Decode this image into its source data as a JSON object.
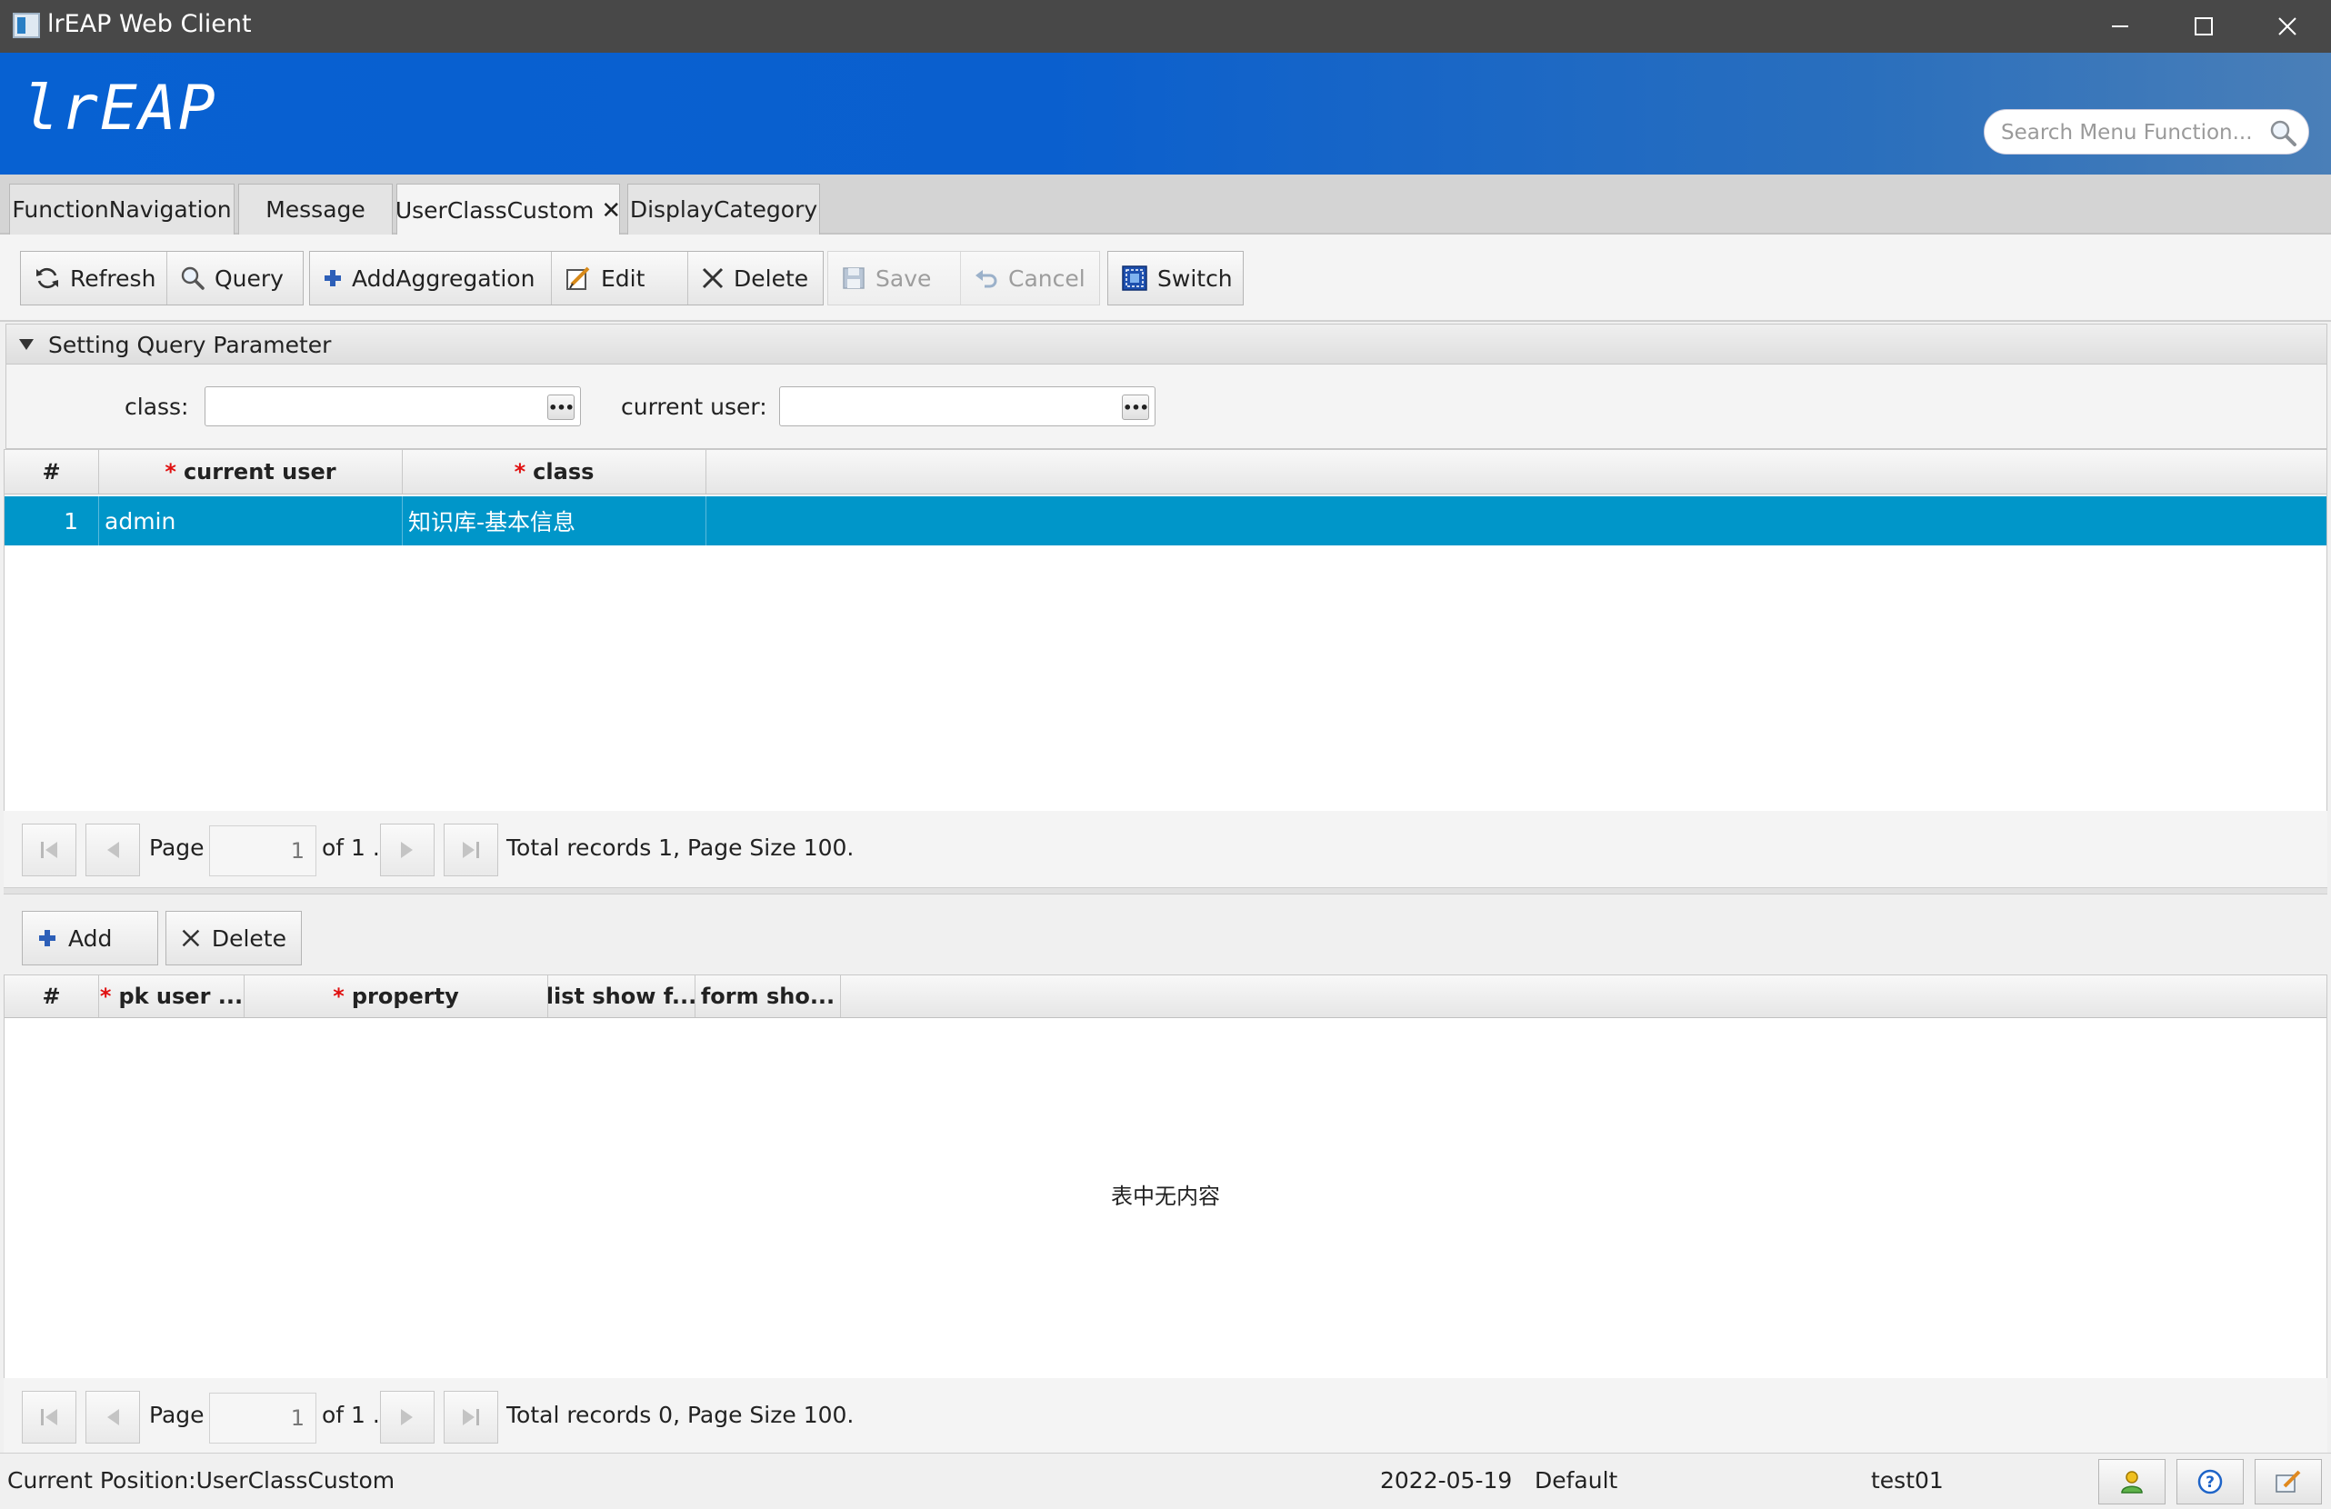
{
  "window": {
    "title": "lrEAP Web Client",
    "minimize": "—",
    "maximize": "☐",
    "close": "✕"
  },
  "banner": {
    "logo": "lrEAP",
    "search_placeholder": "Search Menu Function..."
  },
  "tabs": [
    {
      "label": "FunctionNavigation",
      "active": false
    },
    {
      "label": "Message",
      "active": false
    },
    {
      "label": "UserClassCustom",
      "active": true,
      "closable": true
    },
    {
      "label": "DisplayCategory",
      "active": false
    }
  ],
  "tab_close": "✕",
  "toolbar": {
    "refresh": "Refresh",
    "query": "Query",
    "add_aggregation": "AddAggregation",
    "edit": "Edit",
    "delete": "Delete",
    "save": "Save",
    "cancel": "Cancel",
    "switch": "Switch"
  },
  "query_panel": {
    "title": "Setting Query Parameter",
    "class_label": "class:",
    "class_value": "",
    "current_user_label": "current user:",
    "current_user_value": "",
    "lookup_button": "•••"
  },
  "master_table": {
    "headers": {
      "index": "#",
      "current_user": "current user",
      "class": "class",
      "required_mark": "*"
    },
    "rows": [
      {
        "index": "1",
        "current_user": "admin",
        "class": "知识库-基本信息",
        "selected": true
      }
    ]
  },
  "master_pager": {
    "page_label": "Page",
    "page_value": "1",
    "of_label": "of 1 .",
    "summary": "Total records  1, Page Size 100."
  },
  "detail_toolbar": {
    "add": "Add",
    "delete": "Delete"
  },
  "detail_table": {
    "headers": {
      "index": "#",
      "pk_user": "pk user ...",
      "property": "property",
      "list_show": "list show f...",
      "form_show": "form sho...",
      "required_mark": "*"
    },
    "empty_text": "表中无内容"
  },
  "detail_pager": {
    "page_label": "Page",
    "page_value": "1",
    "of_label": "of 1 .",
    "summary": "Total records  0, Page Size 100."
  },
  "status_bar": {
    "position": "Current Position:UserClassCustom",
    "date": "2022-05-19",
    "scheme": "Default",
    "user": "test01"
  },
  "colors": {
    "banner": "#0761d2",
    "selection": "#0096c9",
    "required": "#e01010"
  }
}
